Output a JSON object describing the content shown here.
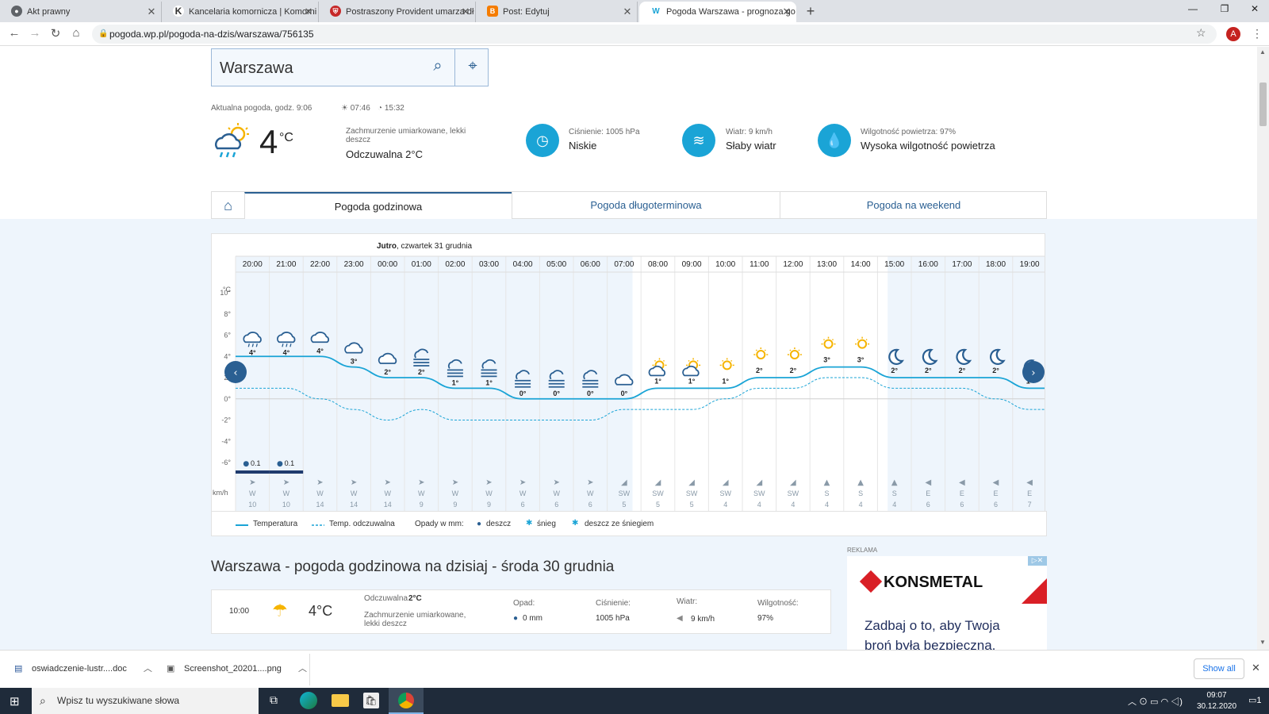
{
  "browser": {
    "tabs": [
      {
        "title": "Akt prawny",
        "icon": "globe-icon",
        "color": "#5f6368"
      },
      {
        "title": "Kancelaria komornicza | Komorni",
        "icon": "k-logo-icon",
        "color": "#333333"
      },
      {
        "title": "Postraszony Provident umarza dł",
        "icon": "shield-icon",
        "color": "#c62828"
      },
      {
        "title": "Post: Edytuj",
        "icon": "blogger-icon",
        "color": "#f57c00"
      },
      {
        "title": "Pogoda Warszawa - prognoza go",
        "icon": "wp-icon",
        "color": "#1aa4d6"
      }
    ],
    "url": "pogoda.wp.pl/pogoda-na-dzis/warszawa/756135",
    "avatar_letter": "A"
  },
  "search": {
    "value": "Warszawa"
  },
  "current": {
    "header": "Aktualna pogoda, godz. 9:06",
    "sunrise": "07:46",
    "sunset": "15:32",
    "temp": "4",
    "unit": "°C",
    "desc": "Zachmurzenie umiarkowane, lekki deszcz",
    "feels": "Odczuwalna 2°C",
    "pressure_label": "Ciśnienie: 1005 hPa",
    "pressure_value": "Niskie",
    "wind_label": "Wiatr: 9 km/h",
    "wind_value": "Słaby wiatr",
    "humidity_label": "Wilgotność powietrza: 97%",
    "humidity_value": "Wysoka wilgotność powietrza"
  },
  "page_tabs": [
    "Pogoda godzinowa",
    "Pogoda długoterminowa",
    "Pogoda na weekend"
  ],
  "chart_header": {
    "bold": "Jutro",
    "rest": ", czwartek 31 grudnia"
  },
  "chart_data": {
    "type": "line",
    "x": [
      "20:00",
      "21:00",
      "22:00",
      "23:00",
      "00:00",
      "01:00",
      "02:00",
      "03:00",
      "04:00",
      "05:00",
      "06:00",
      "07:00",
      "08:00",
      "09:00",
      "10:00",
      "11:00",
      "12:00",
      "13:00",
      "14:00",
      "15:00",
      "16:00",
      "17:00",
      "18:00",
      "19:00"
    ],
    "ylabels": [
      "°C",
      "10°",
      "8°",
      "6°",
      "4°",
      "2°",
      "0°",
      "-2°",
      "-4°",
      "-6°"
    ],
    "ylim": [
      -6,
      10
    ],
    "series": [
      {
        "name": "Temperatura",
        "values": [
          4,
          4,
          4,
          3,
          2,
          2,
          1,
          1,
          0,
          0,
          0,
          0,
          1,
          1,
          1,
          2,
          2,
          3,
          3,
          2,
          2,
          2,
          2,
          1
        ],
        "color": "#1aa4d6",
        "style": "solid"
      },
      {
        "name": "Temp. odczuwalna",
        "values": [
          1,
          1,
          0,
          -1,
          -2,
          -1,
          -2,
          -2,
          -2,
          -2,
          -2,
          -1,
          -1,
          -1,
          0,
          1,
          1,
          2,
          2,
          1,
          1,
          1,
          0,
          -1
        ],
        "color": "#1aa4d6",
        "style": "dashed"
      }
    ],
    "temp_labels": [
      "4°",
      "4°",
      "4°",
      "3°",
      "2°",
      "2°",
      "1°",
      "1°",
      "0°",
      "0°",
      "0°",
      "0°",
      "1°",
      "1°",
      "1°",
      "2°",
      "2°",
      "3°",
      "3°",
      "2°",
      "2°",
      "2°",
      "2°",
      "1°"
    ],
    "icons": [
      "rain-snow",
      "rain-snow",
      "cloud",
      "cloud",
      "cloud",
      "fog",
      "fog",
      "fog",
      "fog",
      "fog",
      "fog",
      "cloud",
      "sun-cloud",
      "sun-cloud",
      "sun",
      "sun",
      "sun",
      "sun",
      "sun",
      "moon",
      "moon",
      "moon",
      "moon",
      "moon"
    ],
    "precip": [
      {
        "index": 0,
        "label": "0.1"
      },
      {
        "index": 1,
        "label": "0.1"
      }
    ],
    "wind_dir": [
      "W",
      "W",
      "W",
      "W",
      "W",
      "W",
      "W",
      "W",
      "W",
      "W",
      "W",
      "SW",
      "SW",
      "SW",
      "SW",
      "SW",
      "SW",
      "S",
      "S",
      "S",
      "E",
      "E",
      "E",
      "E"
    ],
    "wind_speed": [
      "10",
      "10",
      "14",
      "14",
      "14",
      "9",
      "9",
      "9",
      "6",
      "6",
      "6",
      "5",
      "5",
      "5",
      "4",
      "4",
      "4",
      "4",
      "4",
      "4",
      "6",
      "6",
      "6",
      "7"
    ],
    "wind_unit": "km/h"
  },
  "legend": {
    "temp": "Temperatura",
    "feels": "Temp. odczuwalna",
    "precip": "Opady w mm:",
    "rain": "deszcz",
    "snow": "śnieg",
    "mixed": "deszcz ze śniegiem"
  },
  "section_title": "Warszawa - pogoda godzinowa na dzisiaj - środa 30 grudnia",
  "hour_row": {
    "time": "10:00",
    "temp": "4°C",
    "feels_label": "Odczuwalna",
    "feels_value": "2°C",
    "desc": "Zachmurzenie umiarkowane, lekki deszcz",
    "precip_label": "Opad:",
    "precip_value": "0 mm",
    "pressure_label": "Ciśnienie:",
    "pressure_value": "1005 hPa",
    "wind_label": "Wiatr:",
    "wind_value": "9 km/h",
    "humidity_label": "Wilgotność:",
    "humidity_value": "97%"
  },
  "ad": {
    "label": "REKLAMA",
    "brand": "KONSMETAL",
    "line1": "Zadbaj o to, aby Twoja",
    "line2": "broń była bezpieczna."
  },
  "downloads": {
    "file1": "oswiadczenie-lustr....doc",
    "file2": "Screenshot_20201....png",
    "show_all": "Show all"
  },
  "taskbar": {
    "search_placeholder": "Wpisz tu wyszukiwane słowa",
    "time": "09:07",
    "date": "30.12.2020",
    "notifications": "1"
  }
}
